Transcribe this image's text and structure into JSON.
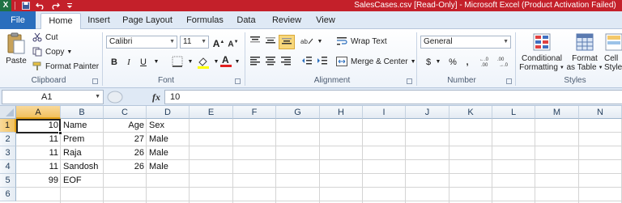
{
  "window": {
    "title": "SalesCases.csv  [Read-Only]  -  Microsoft Excel (Product Activation Failed)",
    "app_icon_letter": "X",
    "title_bar_color": "#c4202a"
  },
  "tabs": {
    "file": "File",
    "items": [
      "Home",
      "Insert",
      "Page Layout",
      "Formulas",
      "Data",
      "Review",
      "View"
    ],
    "active": "Home"
  },
  "ribbon": {
    "clipboard": {
      "label": "Clipboard",
      "paste": "Paste",
      "cut": "Cut",
      "copy": "Copy",
      "format_painter": "Format Painter"
    },
    "font": {
      "label": "Font",
      "font_name": "Calibri",
      "font_size": "11",
      "bold": "B",
      "italic": "I",
      "underline": "U"
    },
    "alignment": {
      "label": "Alignment",
      "wrap_text": "Wrap Text",
      "merge_center": "Merge & Center"
    },
    "number": {
      "label": "Number",
      "format": "General",
      "currency": "$",
      "percent": "%",
      "comma": ","
    },
    "styles": {
      "label": "Styles",
      "conditional_formatting_1": "Conditional",
      "conditional_formatting_2": "Formatting",
      "format_table_1": "Format",
      "format_table_2": "as Table",
      "cell_styles_1": "Cell",
      "cell_styles_2": "Styles"
    }
  },
  "formula_bar": {
    "name_box": "A1",
    "fx_label": "fx",
    "content": "10"
  },
  "sheet": {
    "columns": [
      "A",
      "B",
      "C",
      "D",
      "E",
      "F",
      "G",
      "H",
      "I",
      "J",
      "K",
      "L",
      "M",
      "N"
    ],
    "row_numbers": [
      "1",
      "2",
      "3",
      "4",
      "5",
      "6"
    ],
    "selected_cell": "A1",
    "rows": [
      {
        "A": "10",
        "B": "Name",
        "C": "Age",
        "D": "Sex"
      },
      {
        "A": "11",
        "B": "Prem",
        "C": "27",
        "D": "Male"
      },
      {
        "A": "11",
        "B": "Raja",
        "C": "26",
        "D": "Male"
      },
      {
        "A": "11",
        "B": "Sandosh",
        "C": "26",
        "D": "Male"
      },
      {
        "A": "99",
        "B": "EOF",
        "C": "",
        "D": ""
      },
      {
        "A": "",
        "B": "",
        "C": "",
        "D": ""
      }
    ]
  }
}
